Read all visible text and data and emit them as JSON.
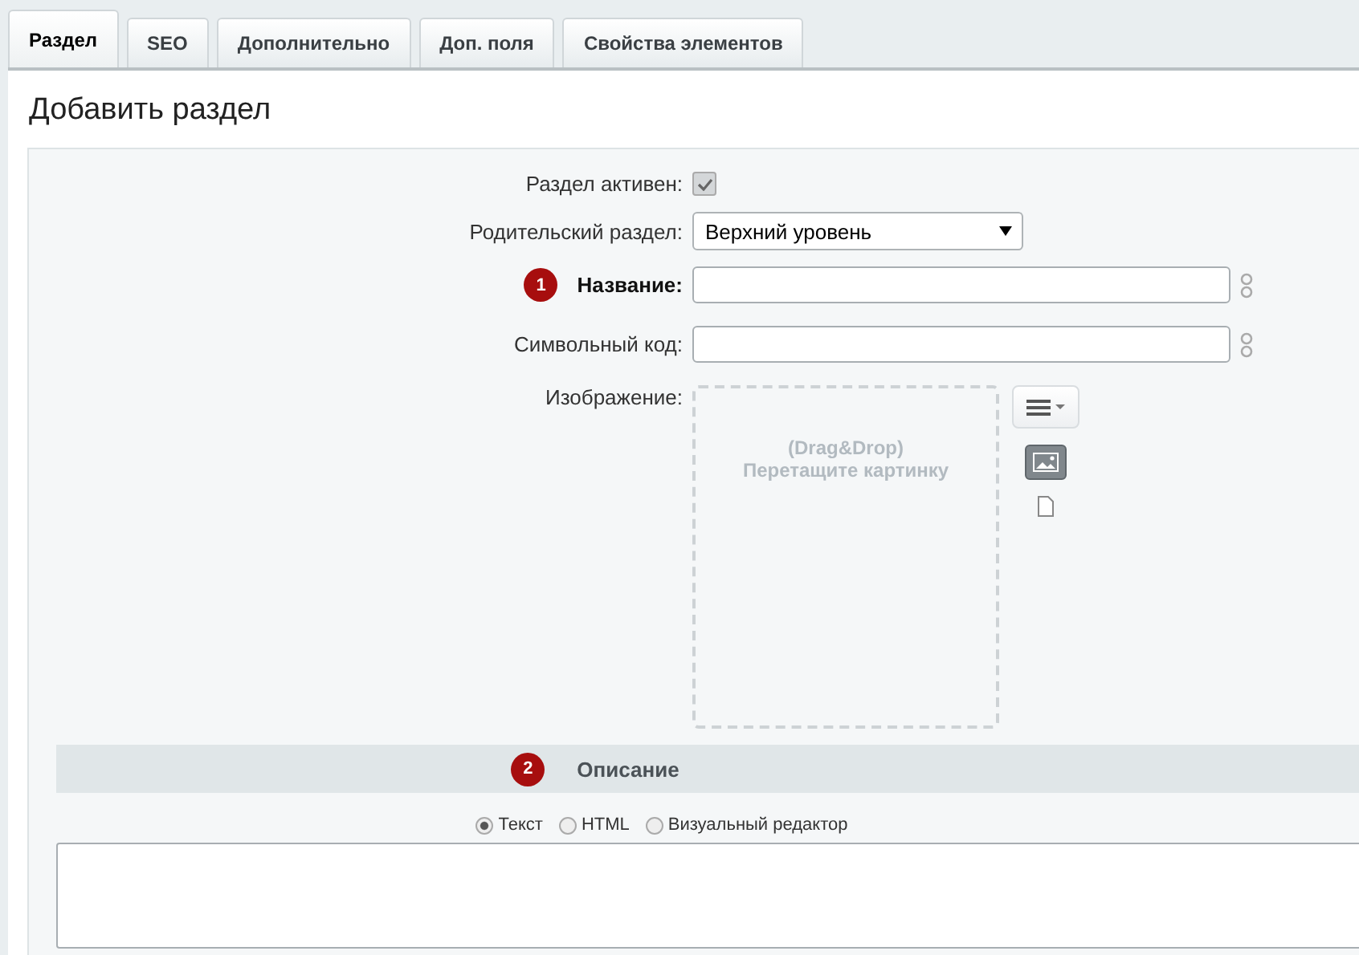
{
  "tabs": [
    {
      "label": "Раздел",
      "selected": true
    },
    {
      "label": "SEO",
      "selected": false
    },
    {
      "label": "Дополнительно",
      "selected": false
    },
    {
      "label": "Доп. поля",
      "selected": false
    },
    {
      "label": "Свойства элементов",
      "selected": false
    }
  ],
  "title": "Добавить раздел",
  "fields": [
    {
      "kind": "checkbox",
      "label": "Раздел активен:",
      "checked": true
    },
    {
      "kind": "select",
      "label": "Родительский раздел:",
      "value": "Верхний уровень"
    },
    {
      "kind": "text",
      "label": "Название:",
      "required": true,
      "badge": "1"
    },
    {
      "kind": "text",
      "label": "Символьный код:",
      "required": false
    },
    {
      "kind": "image",
      "label": "Изображение:",
      "drop_hint_1": "(Drag&Drop)",
      "drop_hint_2": "Перетащите картинку"
    }
  ],
  "section": {
    "title": "Описание",
    "badge": "2"
  },
  "formats": [
    {
      "label": "Текст",
      "selected": true
    },
    {
      "label": "HTML",
      "selected": false
    },
    {
      "label": "Визуальный редактор",
      "selected": false
    }
  ]
}
